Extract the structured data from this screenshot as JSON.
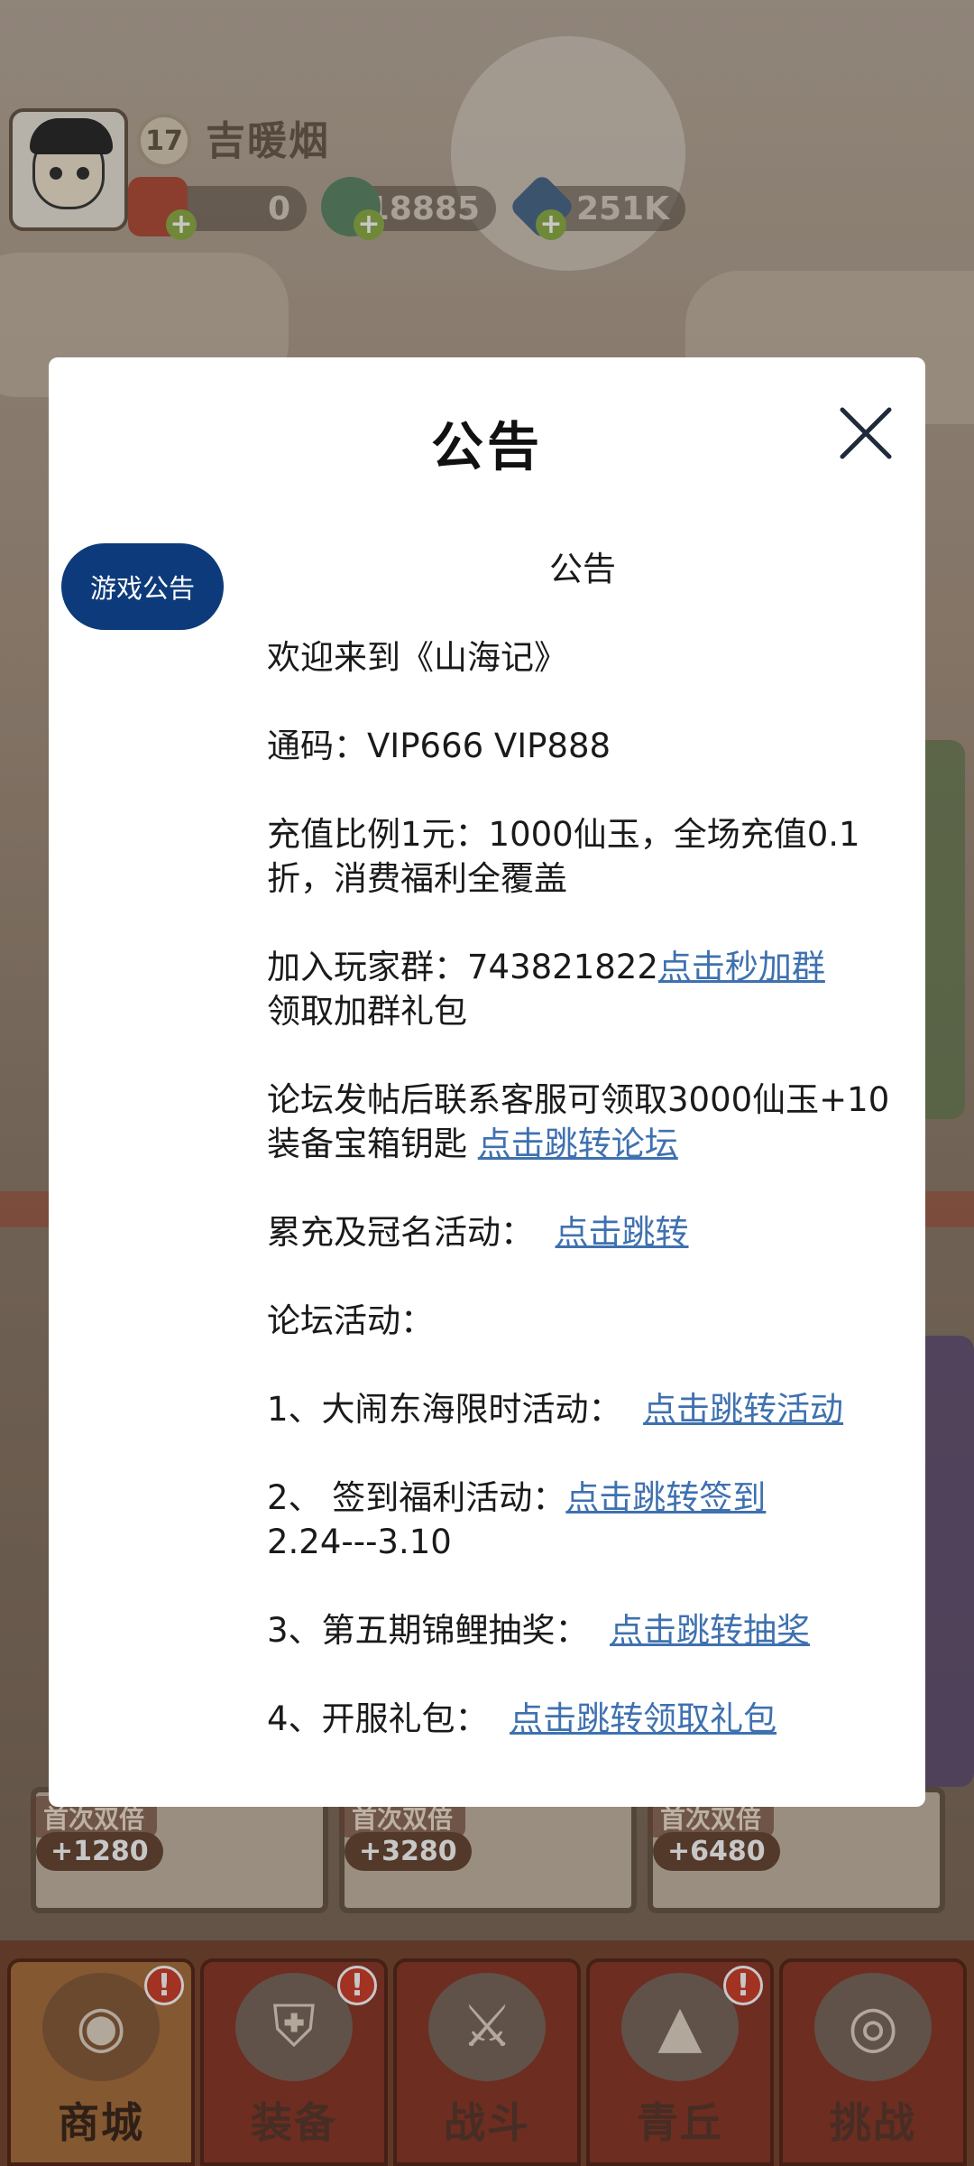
{
  "hud": {
    "level": "17",
    "player_name": "吉暖烟",
    "resources": [
      {
        "icon": "red-envelope-icon",
        "value": "0"
      },
      {
        "icon": "jade-coin-icon",
        "value": "18885"
      },
      {
        "icon": "crystal-icon",
        "value": "251K"
      }
    ]
  },
  "shop_cards": [
    {
      "tag": "首次双倍",
      "bonus": "+1280"
    },
    {
      "tag": "首次双倍",
      "bonus": "+3280"
    },
    {
      "tag": "首次双倍",
      "bonus": "+6480"
    }
  ],
  "nav": [
    {
      "label": "商城",
      "icon": "shop-icon",
      "alert": "!"
    },
    {
      "label": "装备",
      "icon": "helmet-icon",
      "alert": "!"
    },
    {
      "label": "战斗",
      "icon": "crossed-swords-icon",
      "alert": ""
    },
    {
      "label": "青丘",
      "icon": "mountain-icon",
      "alert": "!"
    },
    {
      "label": "挑战",
      "icon": "orb-icon",
      "alert": ""
    }
  ],
  "dialog": {
    "title": "公告",
    "tab_label": "游戏公告",
    "heading": "公告",
    "welcome": "欢迎来到《山海记》",
    "codes": "通码：VIP666 VIP888",
    "recharge": "充值比例1元：1000仙玉，全场充值0.1折，消费福利全覆盖",
    "group_text": "加入玩家群：743821822",
    "group_link": "点击秒加群",
    "group_tail": "领取加群礼包",
    "forum_text": "论坛发帖后联系客服可领取3000仙玉+10装备宝箱钥匙 ",
    "forum_link": "点击跳转论坛",
    "topup_text": "累充及冠名活动：  ",
    "topup_link": "点击跳转",
    "forum_events": "论坛活动：",
    "event1_text": "1、大闹东海限时活动：  ",
    "event1_link": "点击跳转活动",
    "event2_text": "2、 签到福利活动：",
    "event2_link": "点击跳转签到",
    "event2_tail": "2.24---3.10",
    "event3_text": "3、第五期锦鲤抽奖：  ",
    "event3_link": "点击跳转抽奖",
    "event4_text": "4、开服礼包：  ",
    "event4_link": "点击跳转领取礼包"
  }
}
